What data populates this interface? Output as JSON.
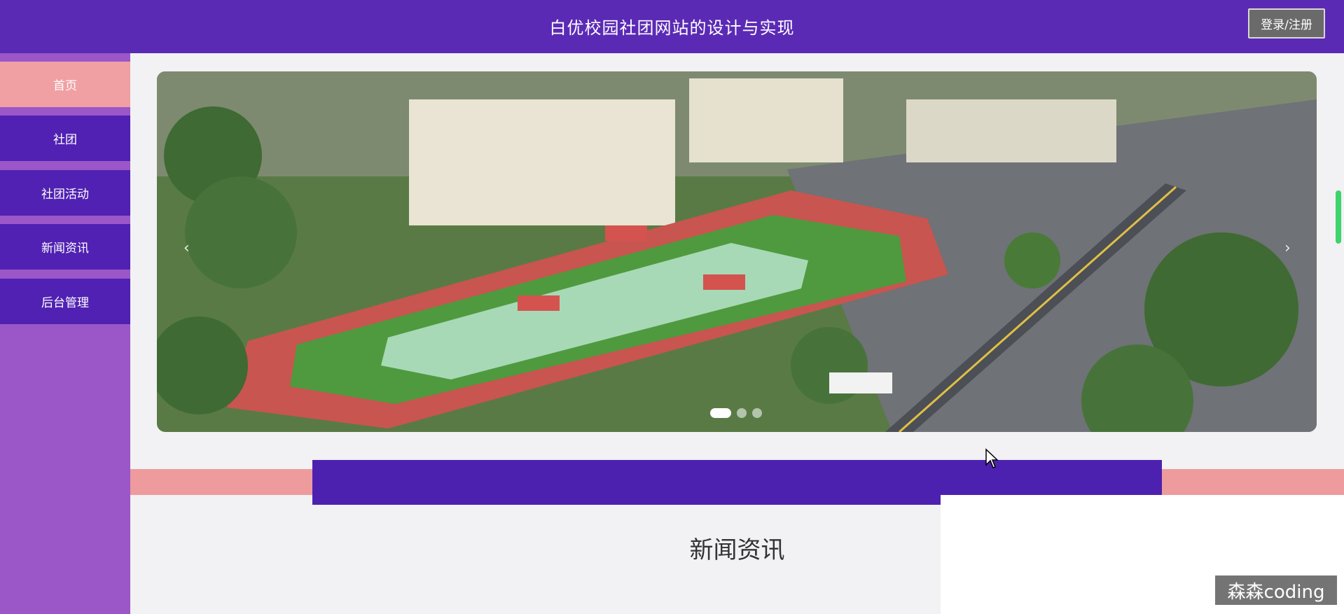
{
  "header": {
    "title": "白优校园社团网站的设计与实现",
    "login_label": "登录/注册"
  },
  "sidebar": {
    "items": [
      {
        "label": "首页",
        "active": true
      },
      {
        "label": "社团",
        "active": false
      },
      {
        "label": "社团活动",
        "active": false
      },
      {
        "label": "新闻资讯",
        "active": false
      },
      {
        "label": "后台管理",
        "active": false
      }
    ]
  },
  "carousel": {
    "prev_icon": "chevron-left-icon",
    "next_icon": "chevron-right-icon",
    "prev_glyph": "‹",
    "next_glyph": "›",
    "slide_count": 3,
    "active_index": 0
  },
  "section": {
    "title": "新闻资讯"
  },
  "watermark": "森森coding",
  "colors": {
    "header": "#5b2ab5",
    "nav_item": "#5021b2",
    "nav_active": "#f0a0a3",
    "sidebar_bg": "#9b57c7",
    "strip_pink": "#ee9b9e",
    "strip_purple": "#4d21b0"
  }
}
